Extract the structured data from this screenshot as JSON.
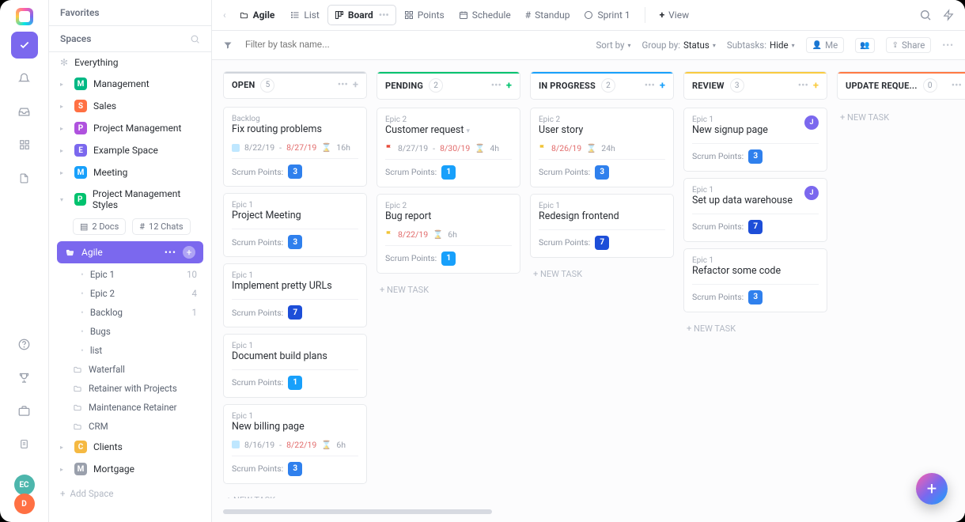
{
  "sidebar": {
    "favorites": "Favorites",
    "spaces": "Spaces",
    "everything": "Everything",
    "items": [
      {
        "letter": "M",
        "color": "#00b884",
        "label": "Management"
      },
      {
        "letter": "S",
        "color": "#ff7043",
        "label": "Sales"
      },
      {
        "letter": "P",
        "color": "#af52de",
        "label": "Project Management"
      },
      {
        "letter": "E",
        "color": "#7b68ee",
        "label": "Example Space"
      },
      {
        "letter": "M",
        "color": "#18a0fb",
        "label": "Meeting"
      }
    ],
    "active_space": {
      "letter": "P",
      "color": "#00c26e",
      "label": "Project Management Styles"
    },
    "docs": "2 Docs",
    "chats": "12 Chats",
    "active_folder": "Agile",
    "leaves": [
      {
        "label": "Epic 1",
        "count": "10"
      },
      {
        "label": "Epic 2",
        "count": "4"
      },
      {
        "label": "Backlog",
        "count": "1"
      },
      {
        "label": "Bugs",
        "count": ""
      },
      {
        "label": "list",
        "count": ""
      }
    ],
    "folders": [
      "Waterfall",
      "Retainer with Projects",
      "Maintenance Retainer",
      "CRM"
    ],
    "tail": [
      {
        "letter": "C",
        "color": "#f5b942",
        "label": "Clients"
      },
      {
        "letter": "M",
        "color": "#9aa0ac",
        "label": "Mortgage"
      }
    ],
    "add": "Add Space"
  },
  "topbar": {
    "crumb": "Agile",
    "views": [
      {
        "icon": "list",
        "label": "List"
      },
      {
        "icon": "board",
        "label": "Board",
        "active": true
      },
      {
        "icon": "points",
        "label": "Points"
      },
      {
        "icon": "schedule",
        "label": "Schedule"
      },
      {
        "icon": "standup",
        "label": "Standup"
      },
      {
        "icon": "sprint",
        "label": "Sprint 1"
      }
    ],
    "addview": "View"
  },
  "toolbar": {
    "filter_ph": "Filter by task name...",
    "sort": "Sort by",
    "group_label": "Group by:",
    "group_value": "Status",
    "sub_label": "Subtasks:",
    "sub_value": "Hide",
    "me": "Me",
    "share": "Share"
  },
  "lanes": [
    {
      "name": "OPEN",
      "count": "5",
      "accent": "#d0d4db",
      "plus": "#c2c7d0",
      "cards": [
        {
          "tag": "Backlog",
          "title": "Fix routing problems",
          "meta": {
            "sq": "#bfe7ff",
            "d1": "8/22/19",
            "d2": "8/27/19",
            "d2_due": true,
            "time": "16h"
          },
          "sp": "3"
        },
        {
          "tag": "Epic 1",
          "title": "Project Meeting",
          "sp": "3"
        },
        {
          "tag": "Epic 1",
          "title": "Implement pretty URLs",
          "sp": "7"
        },
        {
          "tag": "Epic 1",
          "title": "Document build plans",
          "sp": "1"
        },
        {
          "tag": "Epic 1",
          "title": "New billing page",
          "meta": {
            "sq": "#bfe7ff",
            "d1": "8/16/19",
            "d2": "8/22/19",
            "d2_due": true,
            "time": "6h"
          },
          "sp": "3"
        }
      ]
    },
    {
      "name": "PENDING",
      "count": "2",
      "accent": "#00c26e",
      "plus": "#00c26e",
      "cards": [
        {
          "tag": "Epic 2",
          "title": "Customer request",
          "meta": {
            "flag": "#e74c3c",
            "d1": "8/27/19",
            "d2": "8/30/19",
            "d2_due": true,
            "time": "4h"
          },
          "sp": "1",
          "caret": true
        },
        {
          "tag": "Epic 2",
          "title": "Bug report",
          "meta": {
            "flag": "#f0c437",
            "d1": "",
            "d2": "8/22/19",
            "d2_due": true,
            "time": "6h"
          },
          "sp": "1"
        }
      ]
    },
    {
      "name": "IN PROGRESS",
      "count": "2",
      "accent": "#18a0fb",
      "plus": "#18a0fb",
      "cards": [
        {
          "tag": "Epic 2",
          "title": "User story",
          "meta": {
            "flag": "#f0c437",
            "d1": "",
            "d2": "8/26/19",
            "d2_due": true,
            "time": "24h"
          },
          "sp": "3"
        },
        {
          "tag": "Epic 1",
          "title": "Redesign frontend",
          "sp": "7"
        }
      ]
    },
    {
      "name": "REVIEW",
      "count": "3",
      "accent": "#f9cb40",
      "plus": "#f9cb40",
      "cards": [
        {
          "tag": "Epic 1",
          "title": "New signup page",
          "assign": "J",
          "sp": "3"
        },
        {
          "tag": "Epic 1",
          "title": "Set up data warehouse",
          "assign": "J",
          "sp": "7"
        },
        {
          "tag": "Epic 1",
          "title": "Refactor some code",
          "sp": "3"
        }
      ]
    },
    {
      "name": "UPDATE REQUE...",
      "count": "0",
      "accent": "#ff7a45",
      "plus": "#c2c7d0",
      "cards": []
    }
  ],
  "newtask": "+ NEW TASK",
  "sp_label": "Scrum Points:"
}
